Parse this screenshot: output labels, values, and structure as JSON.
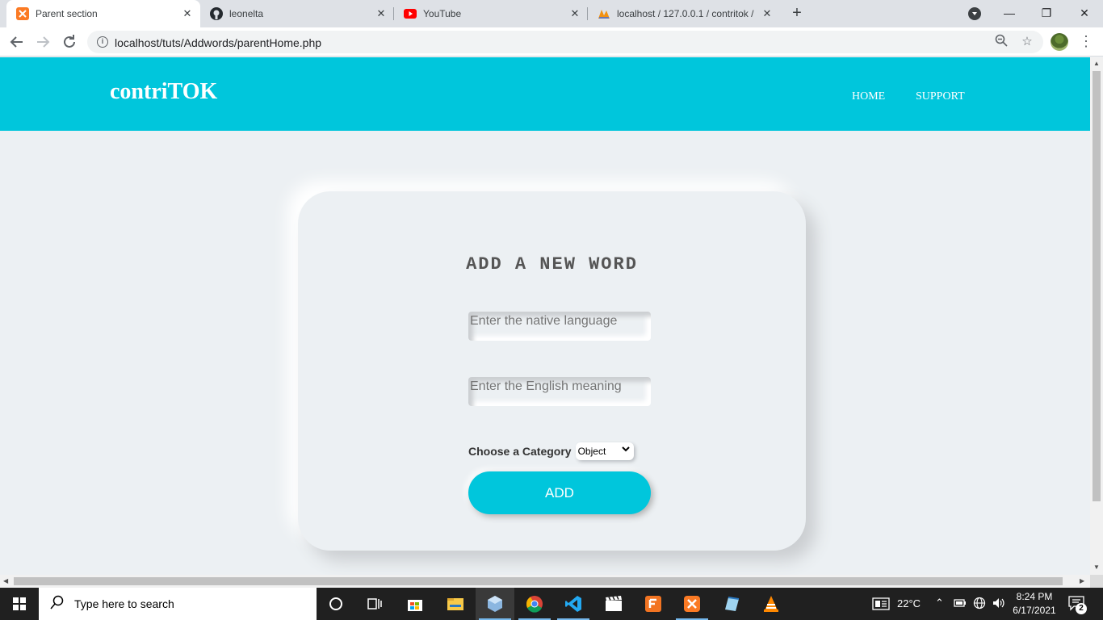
{
  "browser": {
    "tabs": [
      {
        "title": "Parent section",
        "icon": "xampp-icon",
        "active": true
      },
      {
        "title": "leonelta",
        "icon": "github-icon",
        "active": false
      },
      {
        "title": "YouTube",
        "icon": "youtube-icon",
        "active": false
      },
      {
        "title": "localhost / 127.0.0.1 / contritok /",
        "icon": "phpmyadmin-icon",
        "active": false
      }
    ],
    "url": "localhost/tuts/Addwords/parentHome.php",
    "new_tab": "+",
    "controls": {
      "minimize": "—",
      "restore": "❐",
      "close": "✕"
    }
  },
  "site": {
    "logo": "contriTOK",
    "nav": {
      "home": "HOME",
      "support": "SUPPORT"
    },
    "accent_color": "#00c6dc"
  },
  "form": {
    "title": "ADD A NEW WORD",
    "native_placeholder": "Enter the native language",
    "english_placeholder": "Enter the English meaning",
    "category_label": "Choose a Category",
    "category_selected": "Object",
    "submit_label": "ADD"
  },
  "taskbar": {
    "search_placeholder": "Type here to search",
    "apps": [
      "cortana",
      "task-view",
      "microsoft-store",
      "file-explorer",
      "virtualbox",
      "chrome",
      "vscode",
      "video-editor",
      "foxit-pdf",
      "xampp",
      "notepad",
      "vlc"
    ],
    "weather": "22°C",
    "time": "8:24 PM",
    "date": "6/17/2021",
    "notifications": "2"
  }
}
